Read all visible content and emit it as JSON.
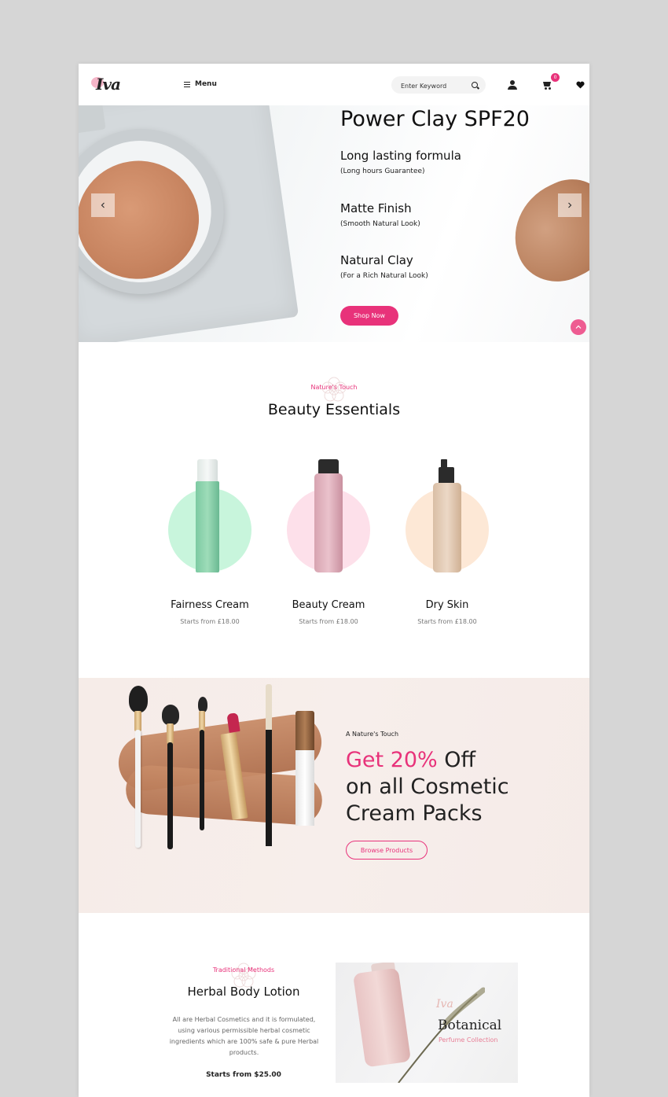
{
  "header": {
    "logo_text": "Iva",
    "menu_label": "Menu",
    "search_placeholder": "Enter Keyword",
    "cart_count": "0",
    "icons": [
      "search-icon",
      "user-icon",
      "cart-icon",
      "heart-icon",
      "menu-icon"
    ]
  },
  "hero": {
    "title": "Power Clay SPF20",
    "features": [
      {
        "title": "Long lasting formula",
        "subtitle": "(Long hours Guarantee)"
      },
      {
        "title": "Matte Finish",
        "subtitle": "(Smooth Natural Look)"
      },
      {
        "title": "Natural Clay",
        "subtitle": "(For a Rich Natural Look)"
      }
    ],
    "cta": "Shop Now"
  },
  "essentials": {
    "subtitle": "Nature's Touch",
    "title": "Beauty Essentials",
    "products": [
      {
        "name": "Fairness Cream",
        "price": "Starts from £18.00",
        "circle_color": "#c8f5dc"
      },
      {
        "name": "Beauty Cream",
        "price": "Starts from £18.00",
        "circle_color": "#fde0ea"
      },
      {
        "name": "Dry Skin",
        "price": "Starts from £18.00",
        "circle_color": "#fde8d6"
      }
    ]
  },
  "promo": {
    "subtitle": "A Nature's Touch",
    "headline_highlight": "Get 20%",
    "headline_rest_1": " Off",
    "headline_line_2": "on all Cosmetic",
    "headline_line_3": "Cream Packs",
    "cta": "Browse Products"
  },
  "herbal": {
    "subtitle": "Traditional Methods",
    "title": "Herbal Body Lotion",
    "description": "All are Herbal Cosmetics and it is formulated, using various permissible herbal cosmetic ingredients which are 100% safe & pure Herbal products.",
    "price": "Starts from $25.00"
  },
  "botanical_banner": {
    "script": "Iva",
    "title": "Botanical",
    "subtitle": "Perfume Collection"
  },
  "colors": {
    "accent": "#e8327a",
    "background": "#ffffff",
    "frame": "#d6d6d6"
  }
}
